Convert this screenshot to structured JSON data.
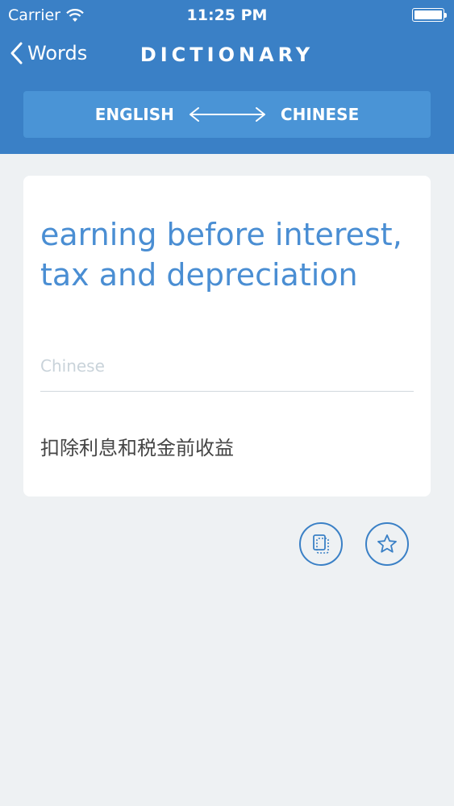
{
  "status": {
    "carrier": "Carrier",
    "time": "11:25 PM"
  },
  "nav": {
    "back_label": "Words",
    "title": "DICTIONARY"
  },
  "language": {
    "from": "ENGLISH",
    "to": "CHINESE"
  },
  "entry": {
    "term": "earning before interest, tax and depreciation",
    "field_label": "Chinese",
    "translation": "扣除利息和税金前收益"
  },
  "icons": {
    "copy": "copy-icon",
    "favorite": "star-icon",
    "swap": "double-arrow-icon",
    "back": "chevron-left-icon",
    "wifi": "wifi-icon"
  },
  "colors": {
    "header": "#3a80c6",
    "accent": "#4a8ed3",
    "background": "#eef1f3"
  }
}
